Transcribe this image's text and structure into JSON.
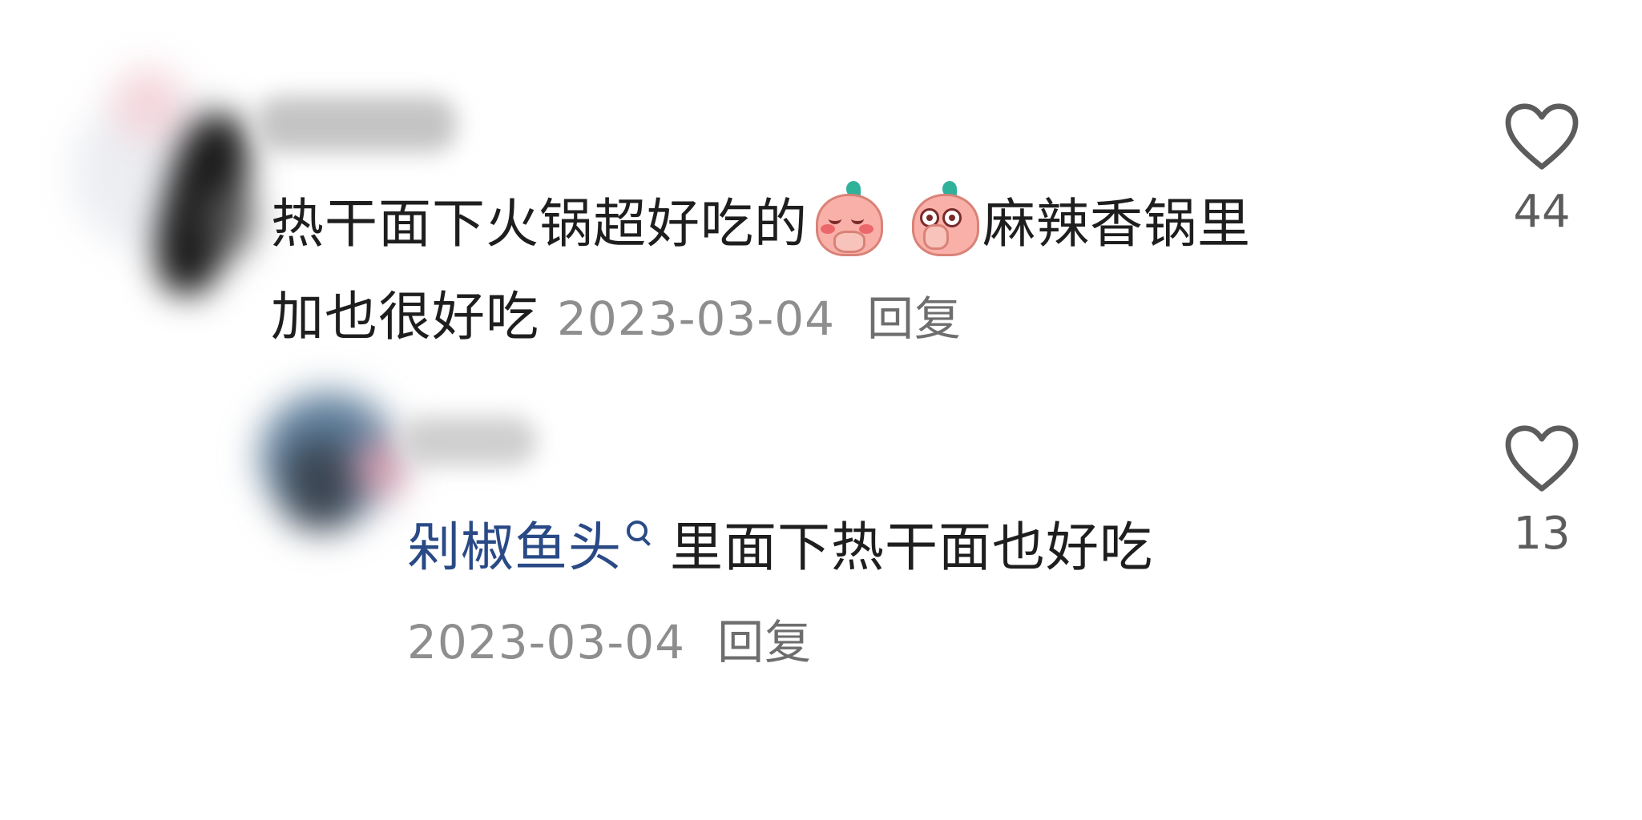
{
  "comments": [
    {
      "text_line1_a": "热干面下火锅超好吃的",
      "emoji_1": "shy-peach-emoji",
      "emoji_2": "surprised-peach-emoji",
      "text_line1_b": "麻辣香锅里",
      "text_line2": "加也很好吃",
      "date": "2023-03-04",
      "reply_label": "回复",
      "like_count": "44"
    },
    {
      "tag": "剁椒鱼头",
      "tag_icon": "search-icon",
      "text": "里面下热干面也好吃",
      "date": "2023-03-04",
      "reply_label": "回复",
      "like_count": "13"
    }
  ],
  "icons": {
    "like": "heart-outline-icon"
  },
  "colors": {
    "text": "#1e1e1e",
    "meta": "#8e8e8e",
    "link": "#2a4a86",
    "icon": "#5c5c5c"
  }
}
